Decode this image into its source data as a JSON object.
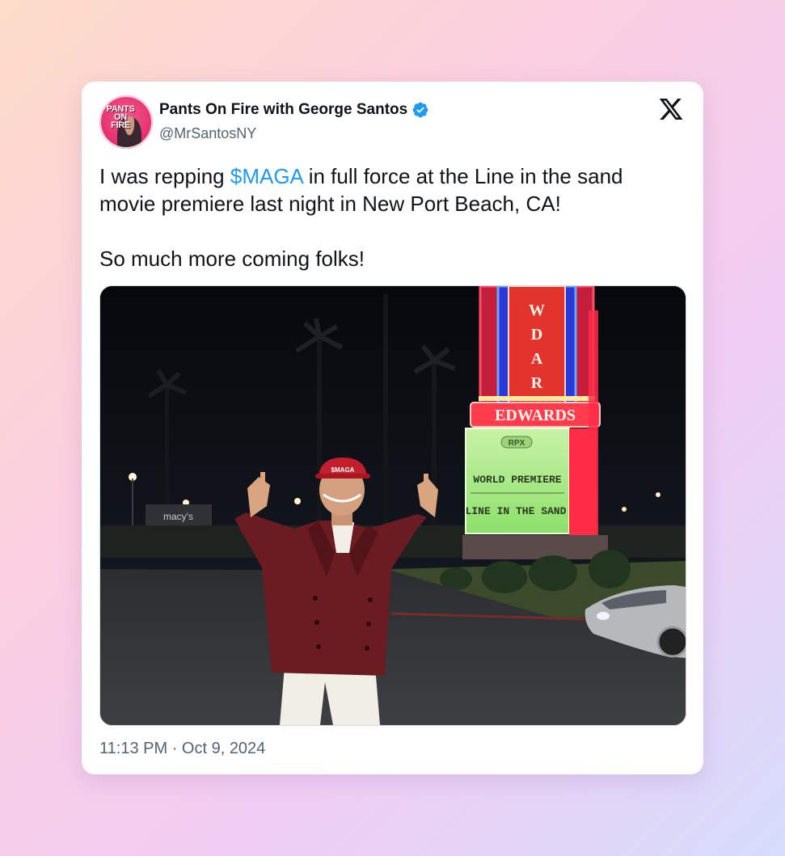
{
  "tweet": {
    "display_name": "Pants On Fire with George Santos",
    "handle": "@MrSantosNY",
    "avatar_text": [
      "PANTS",
      "ON",
      "FIRE"
    ],
    "text_before": "I was repping ",
    "cashtag": "$MAGA",
    "text_after": " in full force at the Line in the sand movie premiere last night in New Port Beach, CA!",
    "text_line2": "So much more coming folks!",
    "time": "11:13 PM",
    "separator": " · ",
    "date": "Oct 9, 2024"
  },
  "media": {
    "marquee_brand": "EDWARDS",
    "marquee_tower": "EDWARDS",
    "marquee_badge": "RPX",
    "marquee_line1": "WORLD PREMIERE",
    "marquee_line2": "LINE IN THE SAND",
    "hat_text": "$MAGA",
    "store_sign": "macy's"
  },
  "colors": {
    "cashtag": "#1d9bf0",
    "verified": "#1d9bf0",
    "text": "#0f1419",
    "secondary": "#536471"
  },
  "icons": {
    "verified": "verified-badge-icon",
    "platform": "x-logo-icon"
  }
}
